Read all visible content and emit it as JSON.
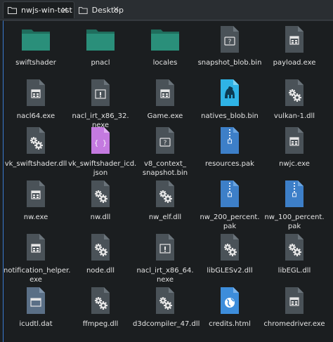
{
  "tabs": [
    {
      "label": "nwjs-win-test",
      "close": "×"
    },
    {
      "label": "Desktop",
      "close": "×"
    }
  ],
  "files": [
    {
      "name": "swiftshader",
      "icon": "folder-icon"
    },
    {
      "name": "pnacl",
      "icon": "folder-icon"
    },
    {
      "name": "locales",
      "icon": "folder-icon"
    },
    {
      "name": "snapshot_blob.bin",
      "icon": "binary-file-icon"
    },
    {
      "name": "payload.exe",
      "icon": "executable-icon"
    },
    {
      "name": "nacl64.exe",
      "icon": "executable-icon"
    },
    {
      "name": "nacl_irt_x86_32.\nnexe",
      "icon": "nexe-file-icon"
    },
    {
      "name": "Game.exe",
      "icon": "executable-icon"
    },
    {
      "name": "natives_blob.bin",
      "icon": "perl-file-icon"
    },
    {
      "name": "vulkan-1.dll",
      "icon": "library-icon"
    },
    {
      "name": "vk_swiftshader.dll",
      "icon": "library-icon"
    },
    {
      "name": "vk_swiftshader_icd.\njson",
      "icon": "json-file-icon"
    },
    {
      "name": "v8_context_\nsnapshot.bin",
      "icon": "binary-file-icon"
    },
    {
      "name": "resources.pak",
      "icon": "archive-icon"
    },
    {
      "name": "nwjc.exe",
      "icon": "executable-icon"
    },
    {
      "name": "nw.exe",
      "icon": "executable-icon"
    },
    {
      "name": "nw.dll",
      "icon": "library-icon"
    },
    {
      "name": "nw_elf.dll",
      "icon": "library-icon"
    },
    {
      "name": "nw_200_percent.\npak",
      "icon": "archive-icon"
    },
    {
      "name": "nw_100_percent.\npak",
      "icon": "archive-icon"
    },
    {
      "name": "notification_helper.\nexe",
      "icon": "executable-icon"
    },
    {
      "name": "node.dll",
      "icon": "library-icon"
    },
    {
      "name": "nacl_irt_x86_64.\nnexe",
      "icon": "nexe-file-icon"
    },
    {
      "name": "libGLESv2.dll",
      "icon": "library-icon"
    },
    {
      "name": "libEGL.dll",
      "icon": "library-icon"
    },
    {
      "name": "icudtl.dat",
      "icon": "data-file-icon"
    },
    {
      "name": "ffmpeg.dll",
      "icon": "library-icon"
    },
    {
      "name": "d3dcompiler_47.dll",
      "icon": "library-icon"
    },
    {
      "name": "credits.html",
      "icon": "html-file-icon"
    },
    {
      "name": "chromedriver.exe",
      "icon": "executable-icon"
    }
  ],
  "colors": {
    "folder": "#2a8f7a",
    "folder_dark": "#1f6d5d",
    "doc": "#4a5258",
    "doc_fold": "#6a737a",
    "json": "#c47ae0",
    "archive": "#3d7fc8",
    "perl": "#2fb3e6",
    "html": "#3d8ddb",
    "accent": "#3a7ad0"
  }
}
